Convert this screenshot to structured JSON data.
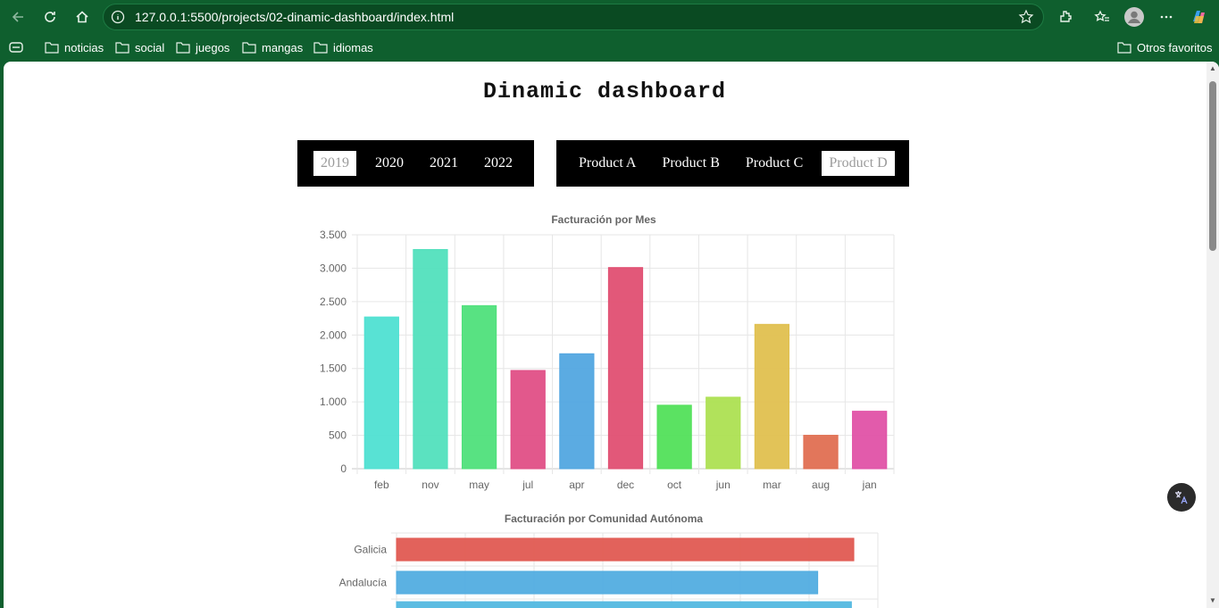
{
  "browser": {
    "url": "127.0.0.1:5500/projects/02-dinamic-dashboard/index.html",
    "bookmarks": [
      "noticias",
      "social",
      "juegos",
      "mangas",
      "idiomas"
    ],
    "other_favorites": "Otros favoritos"
  },
  "page": {
    "title": "Dinamic dashboard",
    "years": [
      {
        "label": "2019",
        "active": true
      },
      {
        "label": "2020",
        "active": false
      },
      {
        "label": "2021",
        "active": false
      },
      {
        "label": "2022",
        "active": false
      }
    ],
    "products": [
      {
        "label": "Product A",
        "active": false
      },
      {
        "label": "Product B",
        "active": false
      },
      {
        "label": "Product C",
        "active": false
      },
      {
        "label": "Product D",
        "active": true
      }
    ]
  },
  "chart_data": [
    {
      "type": "bar",
      "title": "Facturación por Mes",
      "categories": [
        "feb",
        "nov",
        "may",
        "jul",
        "apr",
        "dec",
        "oct",
        "jun",
        "mar",
        "aug",
        "jan"
      ],
      "values": [
        2270,
        3280,
        2440,
        1470,
        1720,
        3010,
        950,
        1070,
        2160,
        500,
        860
      ],
      "colors": [
        "#4fe0d2",
        "#52e0bd",
        "#4fe07b",
        "#e04f86",
        "#52a6e0",
        "#e04f72",
        "#52e05a",
        "#ade052",
        "#e0c04f",
        "#e06f52",
        "#e052a6"
      ],
      "ylim": [
        0,
        3500
      ],
      "yticks": [
        "3.500",
        "3.000",
        "2.500",
        "2.000",
        "1.500",
        "1.000",
        "500",
        "0"
      ],
      "grid": true
    },
    {
      "type": "bar",
      "orientation": "horizontal",
      "title": "Facturación por Comunidad Autónoma",
      "categories": [
        "Galicia",
        "Andalucía"
      ],
      "values": [
        0.95,
        0.875
      ],
      "colors": [
        "#e05a52",
        "#52ade0"
      ],
      "grid": true
    }
  ]
}
